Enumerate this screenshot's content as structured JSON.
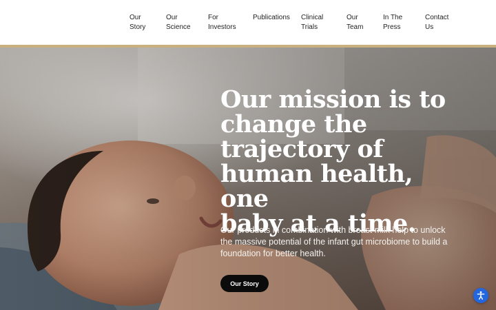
{
  "nav": {
    "items": [
      {
        "line1": "Our",
        "line2": "Story"
      },
      {
        "line1": "Our",
        "line2": "Science"
      },
      {
        "line1": "For",
        "line2": "Investors"
      },
      {
        "line1": "Publications",
        "line2": ""
      },
      {
        "line1": "Clinical",
        "line2": "Trials"
      },
      {
        "line1": "Our",
        "line2": "Team"
      },
      {
        "line1": "In The",
        "line2": "Press"
      },
      {
        "line1": "Contact",
        "line2": "Us"
      }
    ]
  },
  "hero": {
    "headline_lines": [
      "Our mission is to",
      "change the",
      "trajectory of",
      "human health, one",
      "baby at a time."
    ],
    "subtext_lines": [
      "Our products in combination with breast milk help to unlock",
      "the massive potential of the infant gut microbiome to build a",
      "foundation for better health."
    ],
    "cta_label": "Our Story",
    "image_icon": "baby-photo"
  },
  "accessibility": {
    "icon": "accessibility-icon"
  },
  "colors": {
    "accent_bar": "#c8b07f",
    "cta_bg": "#0b0b0b",
    "a11y_bg": "#2367e0"
  }
}
